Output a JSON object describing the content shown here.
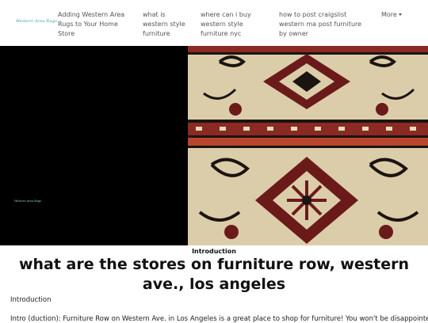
{
  "nav": {
    "logo": "Western Area Rugs",
    "links": [
      "Adding Western Area Rugs to Your Home Store",
      "what is western style furniture",
      "where can i buy western style furniture nyc",
      "how to post craigslist western ma post furniture by owner"
    ],
    "more_label": "More"
  },
  "hero": {
    "logo": "Western Area Rugs",
    "image_icon": "rug-pattern-image",
    "colors": {
      "left_panel": "#000000",
      "rug_base": "#d9c9a5",
      "rug_red": "#6b1a1a",
      "rug_dark": "#1b1410"
    }
  },
  "article": {
    "section_label": "Introduction",
    "title": "what are the stores on furniture row, western ave., los angeles",
    "intro_heading": "Introduction",
    "intro_text": "Intro (duction): Furniture Row on Western Ave. in Los Angeles is a great place to shop for furniture! You won't be disappointed"
  }
}
